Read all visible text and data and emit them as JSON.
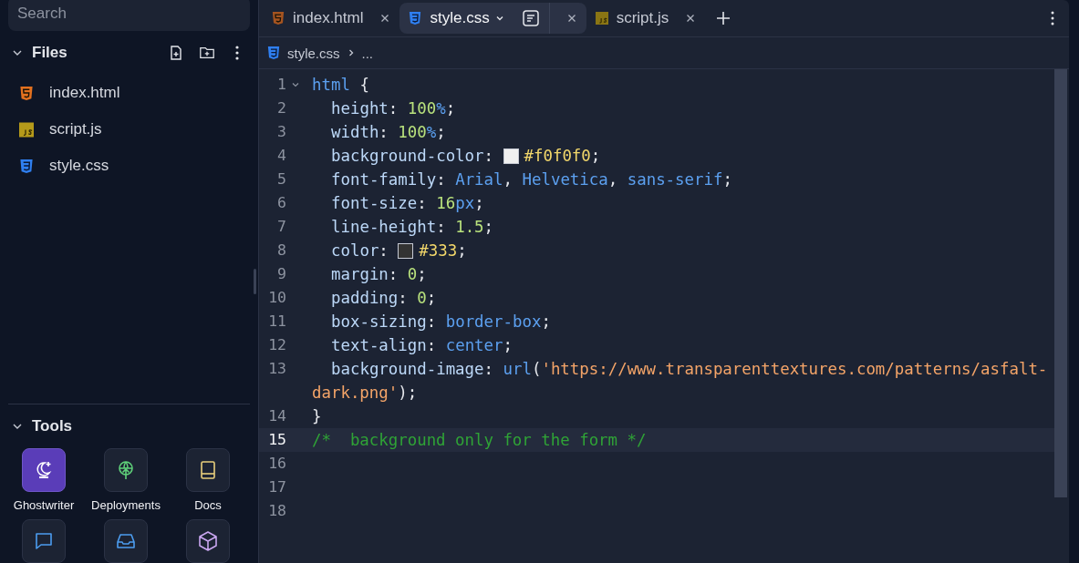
{
  "sidebar": {
    "search": {
      "placeholder": "Search"
    },
    "files_section": {
      "title": "Files",
      "expanded": true,
      "items": [
        {
          "name": "index.html",
          "kind": "html"
        },
        {
          "name": "script.js",
          "kind": "js"
        },
        {
          "name": "style.css",
          "kind": "css"
        }
      ]
    },
    "tools_section": {
      "title": "Tools",
      "expanded": true,
      "items": [
        {
          "label": "Ghostwriter",
          "kind": "ghostwriter",
          "selected": true
        },
        {
          "label": "Deployments",
          "kind": "deployments",
          "selected": false
        },
        {
          "label": "Docs",
          "kind": "docs",
          "selected": false
        },
        {
          "kind": "chat",
          "selected": false
        },
        {
          "kind": "inbox",
          "selected": false
        },
        {
          "kind": "package",
          "selected": false
        }
      ]
    }
  },
  "tabs": [
    {
      "name": "index.html",
      "kind": "html",
      "selected": false
    },
    {
      "name": "style.css",
      "kind": "css",
      "selected": true
    },
    {
      "name": "script.js",
      "kind": "js",
      "selected": false
    }
  ],
  "breadcrumb": {
    "file": "style.css",
    "kind": "css",
    "rest": "..."
  },
  "editor": {
    "lines": [
      {
        "number": "1",
        "current": false,
        "foldable": true,
        "rows": [
          {
            "indented": false,
            "tokens": [
              {
                "kind": "selector",
                "s": "html"
              },
              {
                "kind": "punct",
                "s": "{"
              }
            ]
          }
        ]
      },
      {
        "number": "2",
        "current": false,
        "rows": [
          {
            "indented": true,
            "tokens": [
              {
                "kind": "property",
                "s": "height"
              },
              {
                "kind": "punct",
                "s": ":"
              },
              {
                "kind": "number",
                "s": "100"
              },
              {
                "kind": "unit",
                "s": "%"
              },
              {
                "kind": "punct",
                "s": ";"
              }
            ]
          }
        ]
      },
      {
        "number": "3",
        "current": false,
        "rows": [
          {
            "indented": true,
            "tokens": [
              {
                "kind": "property",
                "s": "width"
              },
              {
                "kind": "punct",
                "s": ":"
              },
              {
                "kind": "number",
                "s": "100"
              },
              {
                "kind": "unit",
                "s": "%"
              },
              {
                "kind": "punct",
                "s": ";"
              }
            ]
          }
        ]
      },
      {
        "number": "4",
        "current": false,
        "rows": [
          {
            "indented": true,
            "tokens": [
              {
                "kind": "property",
                "s": "background-color"
              },
              {
                "kind": "punct",
                "s": ":"
              },
              {
                "kind": "swatch",
                "color": "#f0f0f0"
              },
              {
                "kind": "hex",
                "s": "#f0f0f0"
              },
              {
                "kind": "punct",
                "s": ";"
              }
            ]
          }
        ]
      },
      {
        "number": "5",
        "current": false,
        "rows": [
          {
            "indented": true,
            "tokens": [
              {
                "kind": "property",
                "s": "font-family"
              },
              {
                "kind": "punct",
                "s": ":"
              },
              {
                "kind": "value",
                "s": "Arial"
              },
              {
                "kind": "punct",
                "s": ","
              },
              {
                "kind": "value",
                "s": "Helvetica"
              },
              {
                "kind": "punct",
                "s": ","
              },
              {
                "kind": "value",
                "s": "sans-serif"
              },
              {
                "kind": "punct",
                "s": ";"
              }
            ]
          }
        ]
      },
      {
        "number": "6",
        "current": false,
        "rows": [
          {
            "indented": true,
            "tokens": [
              {
                "kind": "property",
                "s": "font-size"
              },
              {
                "kind": "punct",
                "s": ":"
              },
              {
                "kind": "number",
                "s": "16"
              },
              {
                "kind": "unit",
                "s": "px"
              },
              {
                "kind": "punct",
                "s": ";"
              }
            ]
          }
        ]
      },
      {
        "number": "7",
        "current": false,
        "rows": [
          {
            "indented": true,
            "tokens": [
              {
                "kind": "property",
                "s": "line-height"
              },
              {
                "kind": "punct",
                "s": ":"
              },
              {
                "kind": "number",
                "s": "1.5"
              },
              {
                "kind": "punct",
                "s": ";"
              }
            ]
          }
        ]
      },
      {
        "number": "8",
        "current": false,
        "rows": [
          {
            "indented": true,
            "tokens": [
              {
                "kind": "property",
                "s": "color"
              },
              {
                "kind": "punct",
                "s": ":"
              },
              {
                "kind": "swatch",
                "color": "#333333"
              },
              {
                "kind": "hex",
                "s": "#333"
              },
              {
                "kind": "punct",
                "s": ";"
              }
            ]
          }
        ]
      },
      {
        "number": "9",
        "current": false,
        "rows": [
          {
            "indented": true,
            "tokens": [
              {
                "kind": "property",
                "s": "margin"
              },
              {
                "kind": "punct",
                "s": ":"
              },
              {
                "kind": "number",
                "s": "0"
              },
              {
                "kind": "punct",
                "s": ";"
              }
            ]
          }
        ]
      },
      {
        "number": "10",
        "current": false,
        "rows": [
          {
            "indented": true,
            "tokens": [
              {
                "kind": "property",
                "s": "padding"
              },
              {
                "kind": "punct",
                "s": ":"
              },
              {
                "kind": "number",
                "s": "0"
              },
              {
                "kind": "punct",
                "s": ";"
              }
            ]
          }
        ]
      },
      {
        "number": "11",
        "current": false,
        "rows": [
          {
            "indented": true,
            "tokens": [
              {
                "kind": "property",
                "s": "box-sizing"
              },
              {
                "kind": "punct",
                "s": ":"
              },
              {
                "kind": "value",
                "s": "border-box"
              },
              {
                "kind": "punct",
                "s": ";"
              }
            ]
          }
        ]
      },
      {
        "number": "12",
        "current": false,
        "rows": [
          {
            "indented": true,
            "tokens": [
              {
                "kind": "property",
                "s": "text-align"
              },
              {
                "kind": "punct",
                "s": ":"
              },
              {
                "kind": "value",
                "s": "center"
              },
              {
                "kind": "punct",
                "s": ";"
              }
            ]
          }
        ]
      },
      {
        "number": "13",
        "current": false,
        "rows": [
          {
            "indented": true,
            "tokens": [
              {
                "kind": "property",
                "s": "background-image"
              },
              {
                "kind": "punct",
                "s": ":"
              },
              {
                "kind": "value",
                "s": "url"
              },
              {
                "kind": "punct",
                "s": "("
              },
              {
                "kind": "string",
                "s": "'https://www.transparenttextures.com/patterns/asfalt-"
              }
            ]
          },
          {
            "indented": false,
            "tokens": [
              {
                "kind": "string",
                "s": "dark.png'"
              },
              {
                "kind": "punct",
                "s": ");"
              }
            ]
          }
        ]
      },
      {
        "number": "14",
        "current": false,
        "rows": [
          {
            "indented": false,
            "tokens": [
              {
                "kind": "punct",
                "s": "}"
              }
            ]
          }
        ]
      },
      {
        "number": "15",
        "current": true,
        "rows": [
          {
            "indented": false,
            "tokens": [
              {
                "kind": "comment",
                "s": "/*  background only for the form */"
              }
            ]
          }
        ]
      },
      {
        "number": "16",
        "current": false
      },
      {
        "number": "17",
        "current": false
      },
      {
        "number": "18",
        "current": false
      }
    ]
  }
}
